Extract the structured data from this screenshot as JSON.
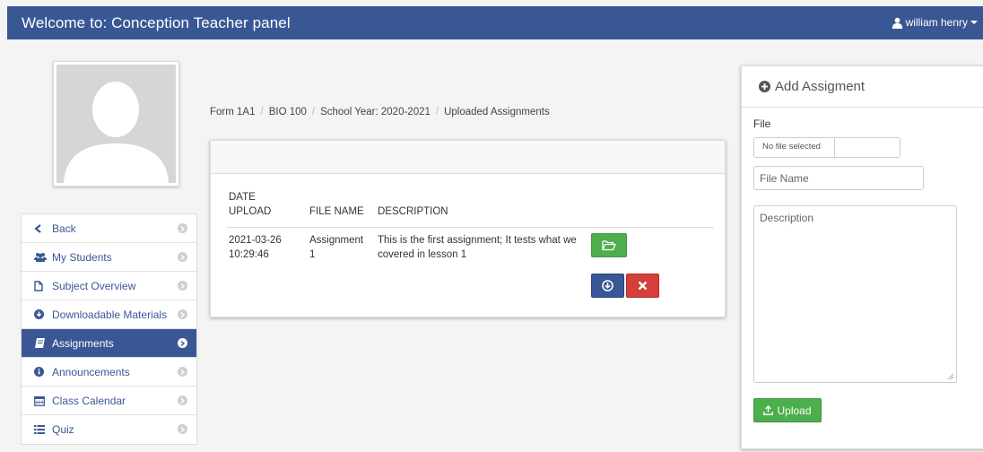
{
  "header": {
    "title": "Welcome to: Conception Teacher panel",
    "user_name": "william henry"
  },
  "sidebar": {
    "items": [
      {
        "label": "Back",
        "icon": "chevron-left-icon"
      },
      {
        "label": "My Students",
        "icon": "users-icon"
      },
      {
        "label": "Subject Overview",
        "icon": "file-icon"
      },
      {
        "label": "Downloadable Materials",
        "icon": "download-circle-icon"
      },
      {
        "label": "Assignments",
        "icon": "book-icon",
        "active": true
      },
      {
        "label": "Announcements",
        "icon": "info-icon"
      },
      {
        "label": "Class Calendar",
        "icon": "calendar-icon"
      },
      {
        "label": "Quiz",
        "icon": "list-icon"
      }
    ]
  },
  "breadcrumb": [
    "Form 1A1",
    "BIO 100",
    "School Year: 2020-2021",
    "Uploaded Assignments"
  ],
  "table": {
    "headers": {
      "date_line1": "DATE",
      "date_line2": "UPLOAD",
      "file_name": "FILE NAME",
      "description": "DESCRIPTION"
    },
    "rows": [
      {
        "date_line1": "2021-03-26",
        "date_line2": "10:29:46",
        "file_name_line1": "Assignment",
        "file_name_line2": "1",
        "desc_line1": "This is the first assignment; It tests what we",
        "desc_line2": "covered in lesson 1"
      }
    ]
  },
  "add_panel": {
    "title": "Add Assigment",
    "file_label": "File",
    "file_status": "No file selected",
    "file_name_placeholder": "File Name",
    "description_placeholder": "Description",
    "upload_label": "Upload"
  },
  "colors": {
    "primary": "#3a5795",
    "success": "#4cae4c",
    "danger": "#d43f3a"
  }
}
